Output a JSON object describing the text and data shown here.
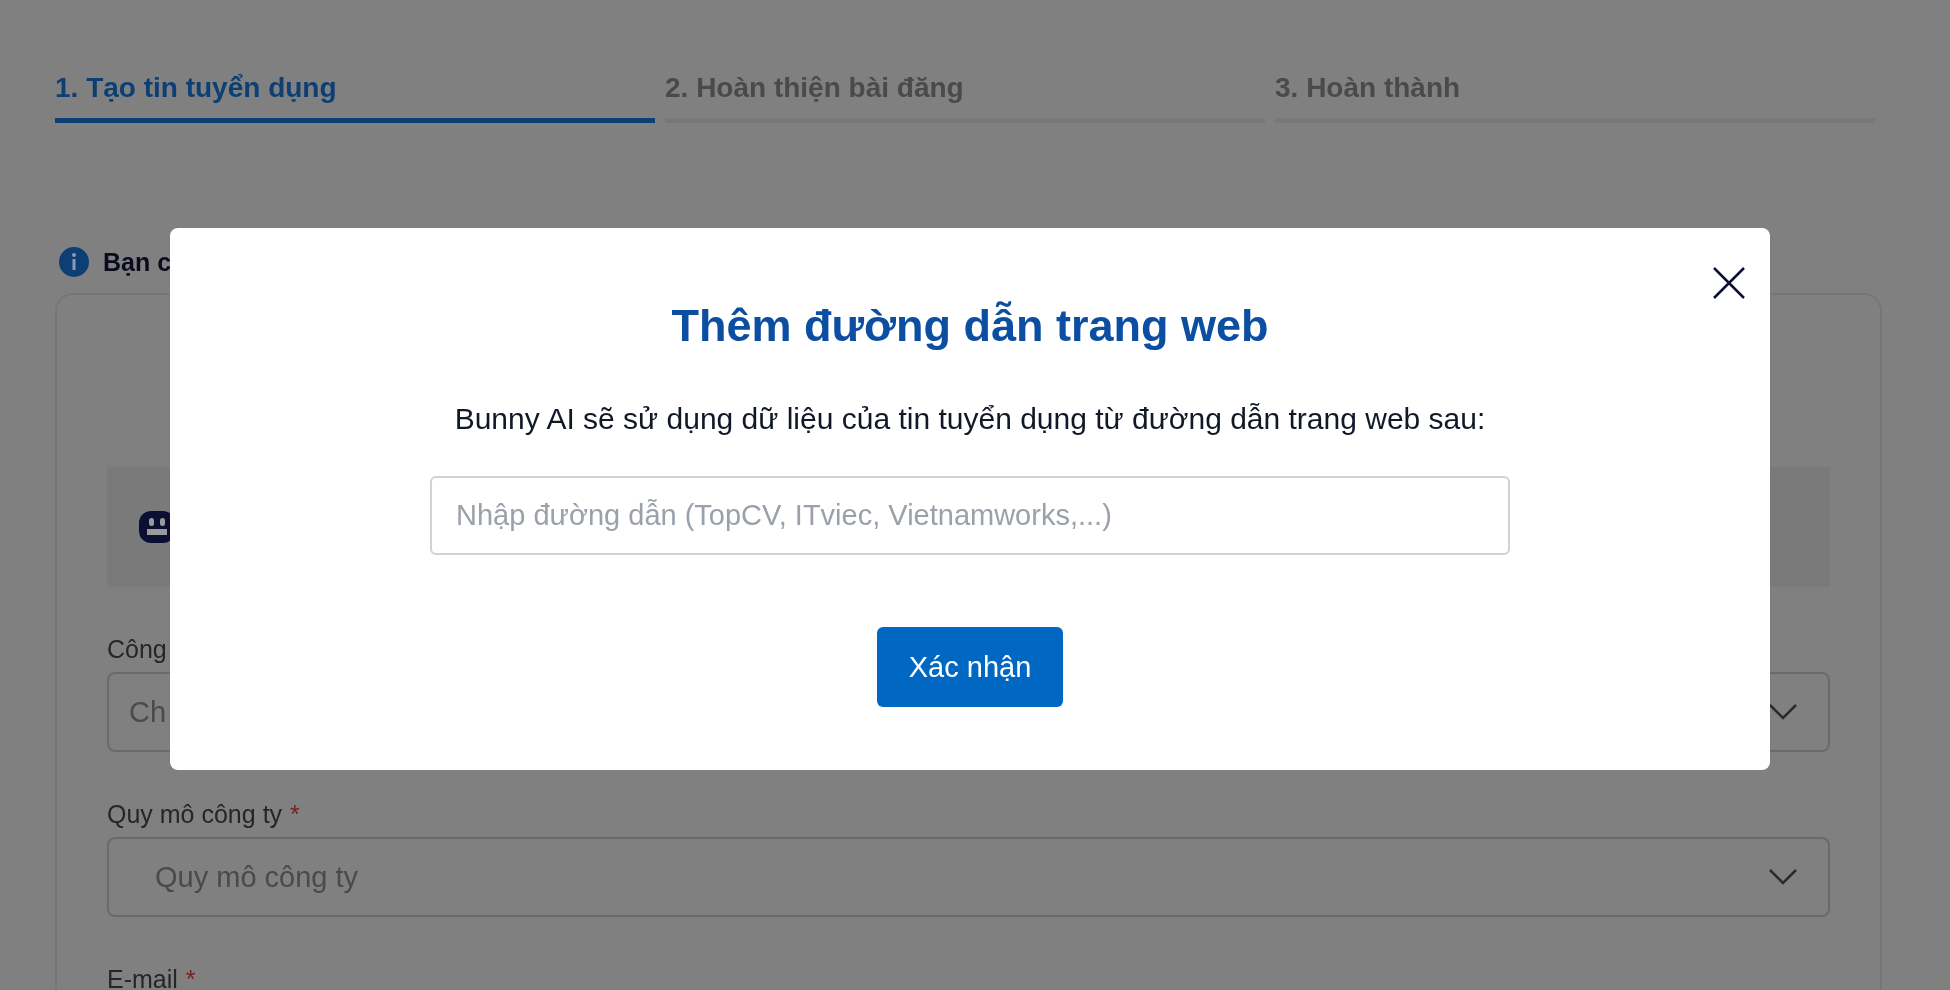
{
  "steps": [
    {
      "label": "1. Tạo tin tuyển dụng",
      "selected": true
    },
    {
      "label": "2. Hoàn thiện bài đăng",
      "selected": false
    },
    {
      "label": "3. Hoàn thành",
      "selected": false
    }
  ],
  "notice": {
    "text": "Bạn c"
  },
  "form": {
    "fields": [
      {
        "label": "Công",
        "placeholder": "Ch"
      },
      {
        "label": "Quy mô công ty",
        "required_mark": "*",
        "placeholder": "Quy mô công ty"
      },
      {
        "label": "E-mail",
        "required_mark": "*"
      }
    ]
  },
  "dialog": {
    "title": "Thêm đường dẫn trang web",
    "message": "Bunny AI sẽ sử dụng dữ liệu của tin tuyển dụng từ đường dẫn trang web sau:",
    "input": {
      "placeholder": "Nhập đường dẫn (TopCV, ITviec, Vietnamworks,...)"
    },
    "confirm_button": "Xác nhận"
  }
}
